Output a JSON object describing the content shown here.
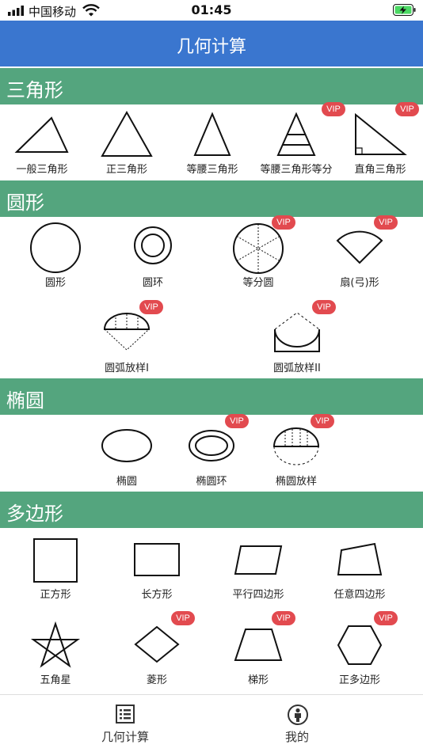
{
  "status": {
    "carrier": "中国移动",
    "time": "01:45"
  },
  "nav": {
    "title": "几何计算"
  },
  "sections": {
    "triangle": {
      "title": "三角形"
    },
    "circle": {
      "title": "圆形"
    },
    "ellipse": {
      "title": "椭圆"
    },
    "polygon": {
      "title": "多边形"
    }
  },
  "items": {
    "general_triangle": "一般三角形",
    "equilateral_triangle": "正三角形",
    "isosceles_triangle": "等腰三角形",
    "isosceles_triangle_div": "等腰三角形等分",
    "right_triangle": "直角三角形",
    "circle": "圆形",
    "annulus": "圆环",
    "equal_division_circle": "等分圆",
    "sector": "扇(弓)形",
    "arc_layout_1": "圆弧放样I",
    "arc_layout_2": "圆弧放样II",
    "ellipse": "椭圆",
    "ellipse_ring": "椭圆环",
    "ellipse_layout": "椭圆放样",
    "square": "正方形",
    "rectangle": "长方形",
    "parallelogram": "平行四边形",
    "quadrilateral": "任意四边形",
    "pentagram": "五角星",
    "rhombus": "菱形",
    "trapezoid": "梯形",
    "regular_polygon": "正多边形"
  },
  "vip_label": "VIP",
  "tabs": {
    "calc": "几何计算",
    "mine": "我的"
  },
  "colors": {
    "nav": "#3a76cf",
    "section": "#54a57e",
    "vip": "#e24a4f",
    "battery": "#4cd964"
  }
}
